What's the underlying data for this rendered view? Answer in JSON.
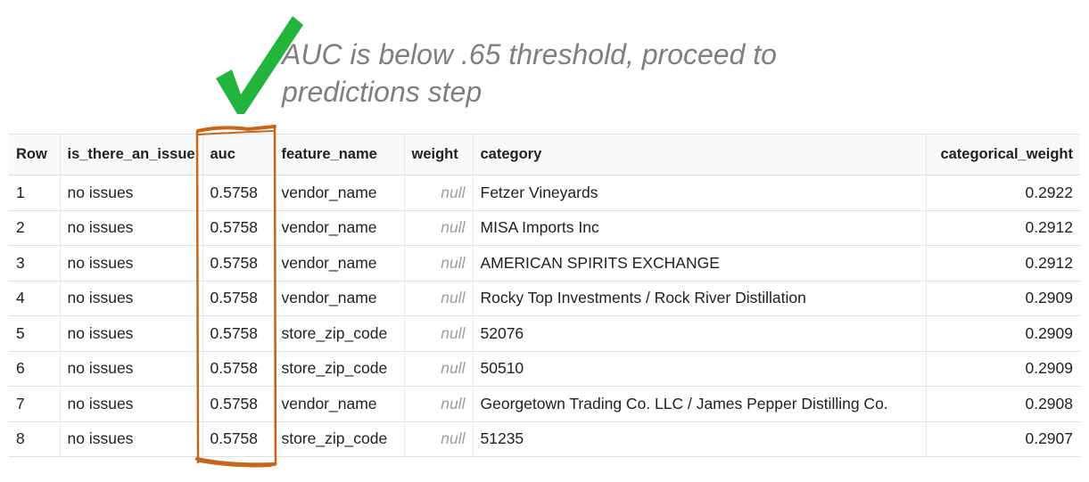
{
  "annotation": {
    "text_line1": "AUC is below .65 threshold, proceed to",
    "text_line2": "predictions step",
    "check_color": "#22b43c",
    "highlight_color": "#c8651b"
  },
  "table": {
    "headers": [
      "Row",
      "is_there_an_issue",
      "auc",
      "feature_name",
      "weight",
      "category",
      "categorical_weight"
    ],
    "rows": [
      {
        "row": "1",
        "issue": "no issues",
        "auc": "0.5758",
        "feature": "vendor_name",
        "weight": "null",
        "category": "Fetzer Vineyards",
        "cat_weight": "0.2922"
      },
      {
        "row": "2",
        "issue": "no issues",
        "auc": "0.5758",
        "feature": "vendor_name",
        "weight": "null",
        "category": "MISA Imports Inc",
        "cat_weight": "0.2912"
      },
      {
        "row": "3",
        "issue": "no issues",
        "auc": "0.5758",
        "feature": "vendor_name",
        "weight": "null",
        "category": "AMERICAN SPIRITS EXCHANGE",
        "cat_weight": "0.2912"
      },
      {
        "row": "4",
        "issue": "no issues",
        "auc": "0.5758",
        "feature": "vendor_name",
        "weight": "null",
        "category": "Rocky Top Investments / Rock River Distillation",
        "cat_weight": "0.2909"
      },
      {
        "row": "5",
        "issue": "no issues",
        "auc": "0.5758",
        "feature": "store_zip_code",
        "weight": "null",
        "category": "52076",
        "cat_weight": "0.2909"
      },
      {
        "row": "6",
        "issue": "no issues",
        "auc": "0.5758",
        "feature": "store_zip_code",
        "weight": "null",
        "category": "50510",
        "cat_weight": "0.2909"
      },
      {
        "row": "7",
        "issue": "no issues",
        "auc": "0.5758",
        "feature": "vendor_name",
        "weight": "null",
        "category": "Georgetown Trading Co. LLC / James Pepper Distilling Co.",
        "cat_weight": "0.2908"
      },
      {
        "row": "8",
        "issue": "no issues",
        "auc": "0.5758",
        "feature": "store_zip_code",
        "weight": "null",
        "category": "51235",
        "cat_weight": "0.2907"
      }
    ]
  }
}
